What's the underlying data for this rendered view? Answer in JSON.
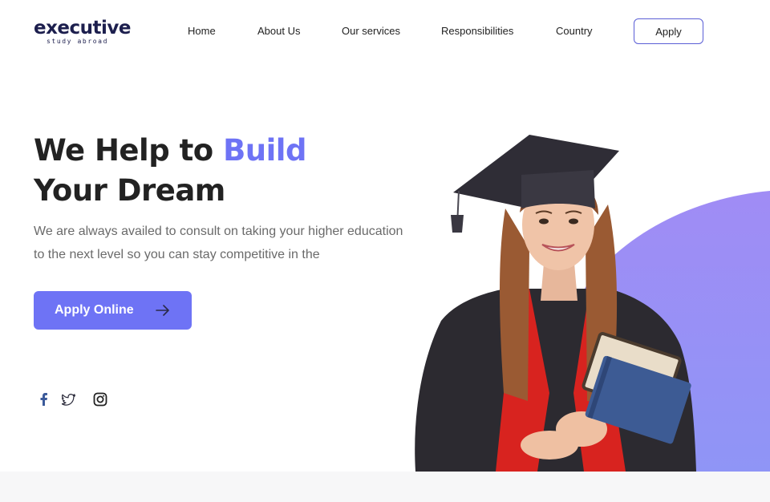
{
  "brand": {
    "name": "executive",
    "tagline": "study abroad",
    "color": "#1d1f4e"
  },
  "nav": {
    "items": [
      {
        "label": "Home"
      },
      {
        "label": "About Us"
      },
      {
        "label": "Our services"
      },
      {
        "label": "Responsibilities"
      },
      {
        "label": "Country"
      }
    ],
    "apply_label": "Apply"
  },
  "hero": {
    "title_part1": "We Help to ",
    "title_accent": "Build",
    "title_line2": "Your Dream",
    "subtitle": "We are always availed to consult on taking your higher education to the next level so you can stay competitive in the",
    "cta_label": "Apply Online",
    "cta_icon": "arrow-right-icon"
  },
  "social": {
    "icons": [
      "facebook-icon",
      "twitter-icon",
      "instagram-icon"
    ]
  },
  "image": {
    "subject": "graduate-student-photo"
  },
  "colors": {
    "accent": "#6e73f5",
    "blob_start": "#a08cf5",
    "blob_end": "#8f95f6",
    "text": "#222222",
    "muted": "#6a6a6a"
  }
}
